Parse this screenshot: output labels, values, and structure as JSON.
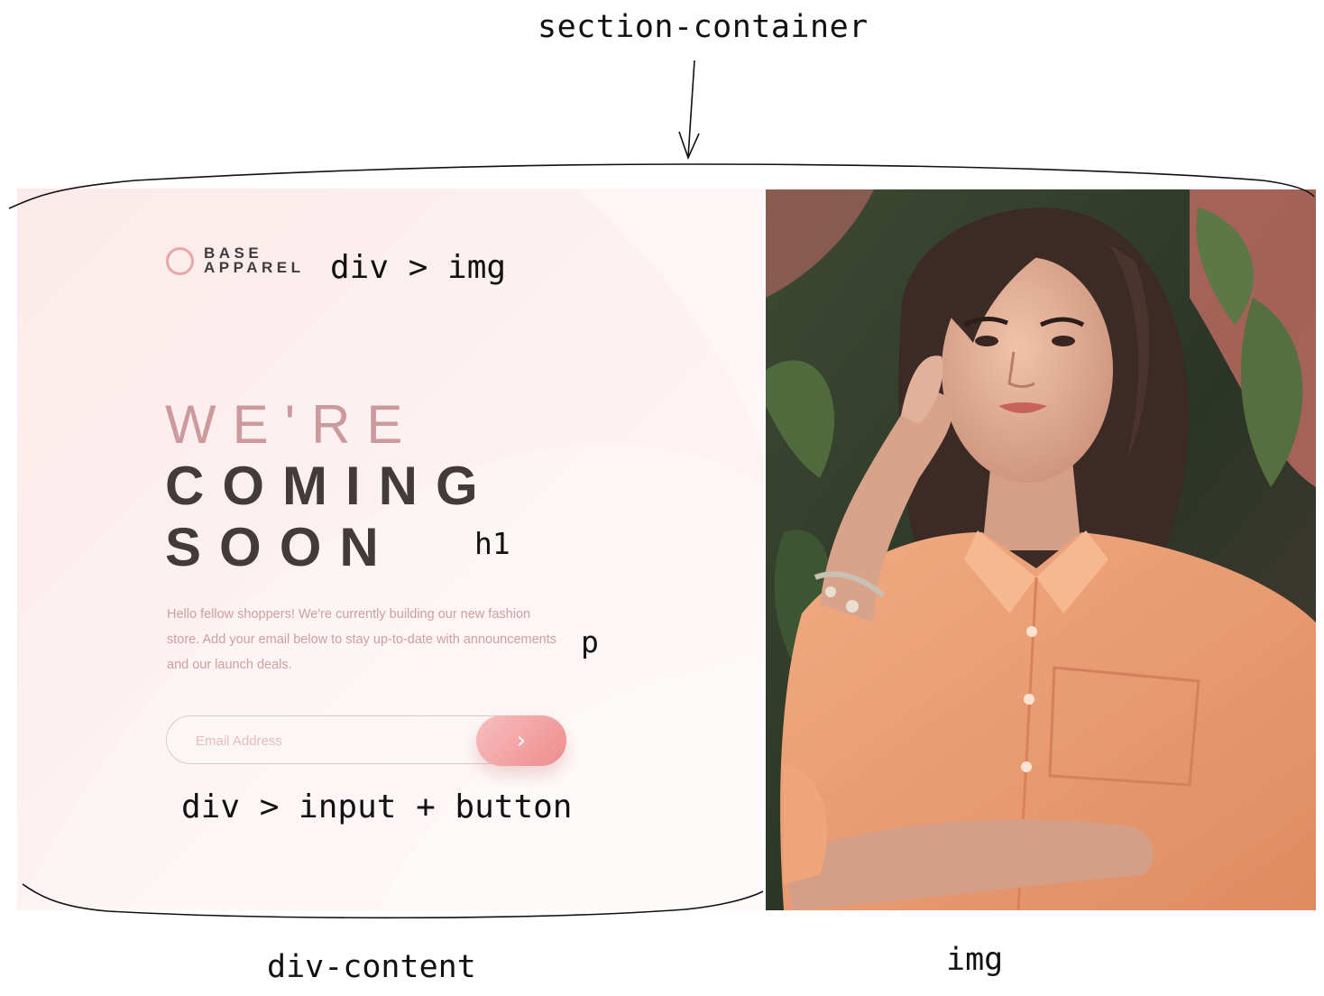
{
  "annotations": {
    "section": "section-container",
    "logo": "div > img",
    "heading": "h1",
    "paragraph": "p",
    "form": "div > input + button",
    "content": "div-content",
    "image": "img"
  },
  "logo": {
    "line1": "BASE",
    "line2": "APPAREL",
    "icon": "ring-icon"
  },
  "heading": {
    "line1": "WE'RE",
    "line2": "COMING",
    "line3": "SOON"
  },
  "intro": "Hello fellow shoppers! We're currently building our new fashion store. Add your email below to stay up-to-date with announcements and our launch deals.",
  "form": {
    "placeholder": "Email Address",
    "submit_icon": "chevron-right-icon",
    "submit_glyph": "›"
  },
  "colors": {
    "panel_bg": "#fbeaea",
    "accent_light": "#cc9a9c",
    "text_dark": "#433a3c",
    "button_from": "#f8bfbf",
    "button_to": "#ee8b8b",
    "annotation_ink": "#111111"
  }
}
